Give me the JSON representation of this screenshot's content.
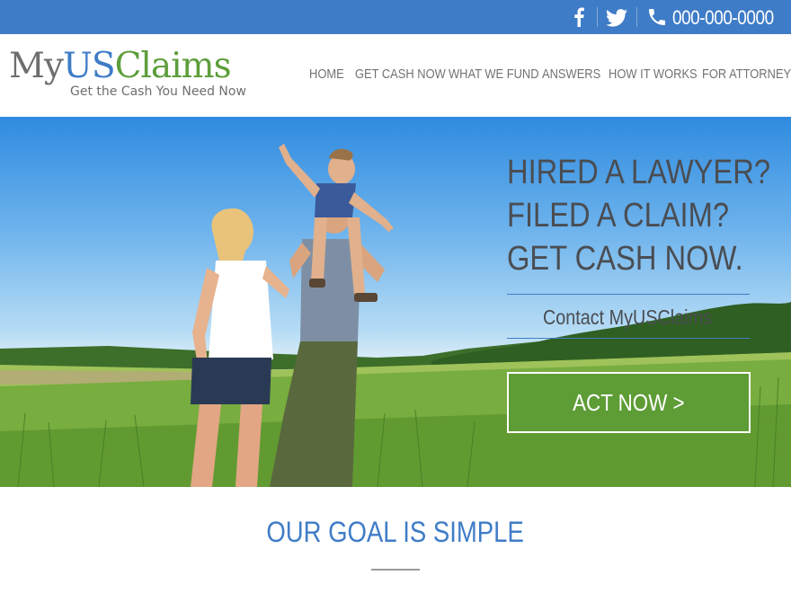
{
  "topbar": {
    "phone": "000-000-0000",
    "icons": [
      "facebook-icon",
      "twitter-icon",
      "phone-icon"
    ],
    "color": "#3f7cc7"
  },
  "logo": {
    "part_my": "My",
    "part_us": "US",
    "part_claims": "Claims",
    "tagline": "Get the Cash You Need Now"
  },
  "nav": {
    "items": [
      "HOME",
      "GET CASH NOW",
      "WHAT WE FUND",
      "ANSWERS",
      "HOW IT WORKS",
      "FOR ATTORNEYS"
    ]
  },
  "hero": {
    "headline": [
      "HIRED A LAWYER?",
      "FILED A CLAIM?",
      "GET CASH NOW."
    ],
    "contact": "Contact MyUSClaims",
    "cta": "ACT NOW >",
    "cta_color": "#5e9c35"
  },
  "section": {
    "title": "OUR GOAL IS SIMPLE"
  }
}
